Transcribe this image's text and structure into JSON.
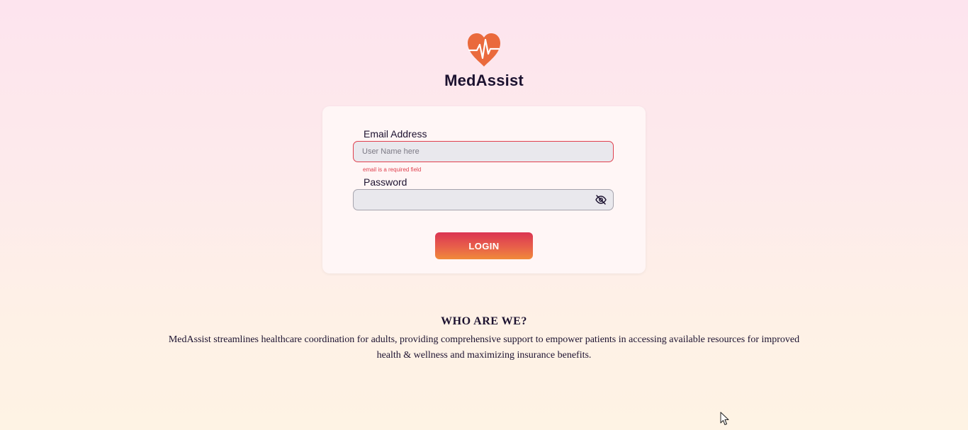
{
  "brand": {
    "name": "MedAssist",
    "logo_icon": "heart-pulse-icon",
    "logo_color": "#ea6a3c"
  },
  "login_form": {
    "email": {
      "label": "Email Address",
      "placeholder": "User Name here",
      "value": "",
      "error": "email is a required field"
    },
    "password": {
      "label": "Password",
      "value": "",
      "toggle_icon": "eye-slash-icon"
    },
    "submit_label": "LOGIN"
  },
  "about": {
    "heading": "WHO ARE WE?",
    "text": "MedAssist streamlines healthcare coordination for adults, providing comprehensive support to empower patients in accessing available resources for improved health & wellness and maximizing insurance benefits."
  },
  "colors": {
    "error": "#e0404e",
    "button_gradient_top": "#db3553",
    "button_gradient_bottom": "#f08a3a",
    "text": "#1c1230"
  }
}
